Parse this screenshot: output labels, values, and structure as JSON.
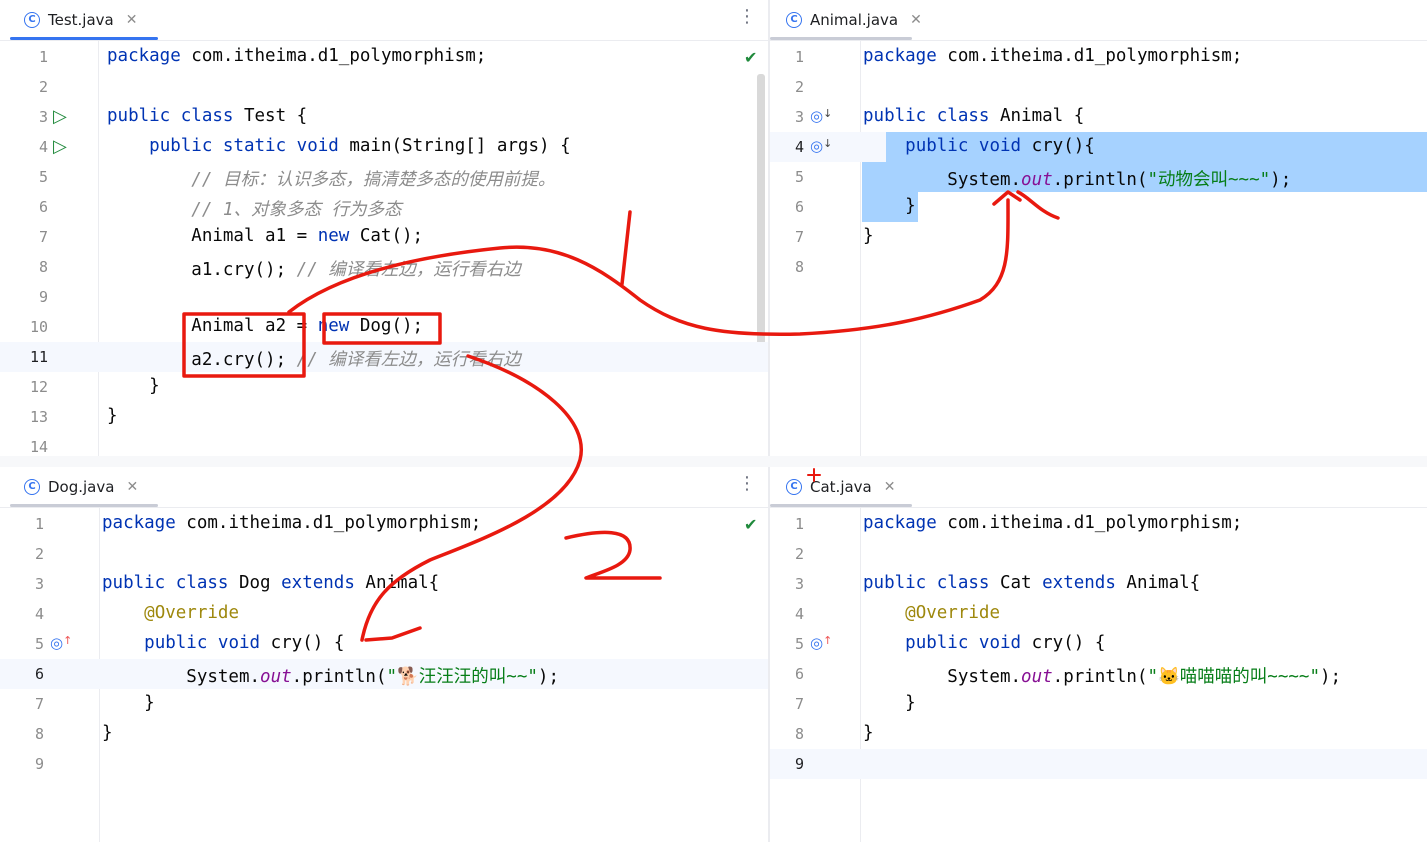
{
  "panes": {
    "test": {
      "tab": "Test.java",
      "lines": [
        {
          "n": "1",
          "code": [
            {
              "t": "package",
              "c": "kw"
            },
            {
              "t": " com.itheima.d1_polymorphism;"
            }
          ]
        },
        {
          "n": "2",
          "code": []
        },
        {
          "n": "3",
          "code": [
            {
              "t": "public class",
              "c": "kw"
            },
            {
              "t": " Test {"
            }
          ],
          "icon": "run"
        },
        {
          "n": "4",
          "code": [
            {
              "t": "    "
            },
            {
              "t": "public static void",
              "c": "kw"
            },
            {
              "t": " main(String[] args) {"
            }
          ],
          "icon": "run"
        },
        {
          "n": "5",
          "code": [
            {
              "t": "        "
            },
            {
              "t": "// 目标：认识多态，搞清楚多态的使用前提。",
              "c": "cm"
            }
          ]
        },
        {
          "n": "6",
          "code": [
            {
              "t": "        "
            },
            {
              "t": "// 1、对象多态 行为多态",
              "c": "cm"
            }
          ]
        },
        {
          "n": "7",
          "code": [
            {
              "t": "        Animal a1 = "
            },
            {
              "t": "new",
              "c": "kw"
            },
            {
              "t": " Cat();"
            }
          ]
        },
        {
          "n": "8",
          "code": [
            {
              "t": "        a1.cry(); "
            },
            {
              "t": "// 编译看左边，运行看右边",
              "c": "cm"
            }
          ]
        },
        {
          "n": "9",
          "code": []
        },
        {
          "n": "10",
          "code": [
            {
              "t": "        Animal a2 = "
            },
            {
              "t": "new",
              "c": "kw"
            },
            {
              "t": " Dog();"
            }
          ]
        },
        {
          "n": "11",
          "code": [
            {
              "t": "        a2.cry(); "
            },
            {
              "t": "// 编译看左边，运行看右边",
              "c": "cm"
            }
          ],
          "current": true
        },
        {
          "n": "12",
          "code": [
            {
              "t": "    }"
            }
          ]
        },
        {
          "n": "13",
          "code": [
            {
              "t": "}"
            }
          ]
        },
        {
          "n": "14",
          "code": []
        }
      ]
    },
    "animal": {
      "tab": "Animal.java",
      "lines": [
        {
          "n": "1",
          "code": [
            {
              "t": "package",
              "c": "kw"
            },
            {
              "t": " com.itheima.d1_polymorphism;"
            }
          ]
        },
        {
          "n": "2",
          "code": []
        },
        {
          "n": "3",
          "code": [
            {
              "t": "public class",
              "c": "kw"
            },
            {
              "t": " Animal {"
            }
          ],
          "icon": "ovdown"
        },
        {
          "n": "4",
          "code": [
            {
              "t": "    "
            },
            {
              "t": "public void",
              "c": "kw"
            },
            {
              "t": " cry(){"
            }
          ],
          "icon": "ovdown",
          "current": true,
          "sel": true
        },
        {
          "n": "5",
          "code": [
            {
              "t": "        System."
            },
            {
              "t": "out",
              "c": "fld"
            },
            {
              "t": ".println("
            },
            {
              "t": "\"动物会叫~~~\"",
              "c": "st"
            },
            {
              "t": ");"
            }
          ],
          "sel": true
        },
        {
          "n": "6",
          "code": [
            {
              "t": "    }"
            }
          ],
          "sel": true
        },
        {
          "n": "7",
          "code": [
            {
              "t": "}"
            }
          ]
        },
        {
          "n": "8",
          "code": []
        }
      ]
    },
    "dog": {
      "tab": "Dog.java",
      "lines": [
        {
          "n": "1",
          "code": [
            {
              "t": "package",
              "c": "kw"
            },
            {
              "t": " com.itheima.d1_polymorphism;"
            }
          ]
        },
        {
          "n": "2",
          "code": []
        },
        {
          "n": "3",
          "code": [
            {
              "t": "public class",
              "c": "kw"
            },
            {
              "t": " Dog "
            },
            {
              "t": "extends",
              "c": "kw"
            },
            {
              "t": " Animal{"
            }
          ]
        },
        {
          "n": "4",
          "code": [
            {
              "t": "    "
            },
            {
              "t": "@Override",
              "c": "an"
            }
          ]
        },
        {
          "n": "5",
          "code": [
            {
              "t": "    "
            },
            {
              "t": "public void",
              "c": "kw"
            },
            {
              "t": " cry() {"
            }
          ],
          "icon": "ovup"
        },
        {
          "n": "6",
          "code": [
            {
              "t": "        System."
            },
            {
              "t": "out",
              "c": "fld"
            },
            {
              "t": ".println("
            },
            {
              "t": "\"🐕汪汪汪的叫~~\"",
              "c": "st"
            },
            {
              "t": ");"
            }
          ],
          "current": true
        },
        {
          "n": "7",
          "code": [
            {
              "t": "    }"
            }
          ]
        },
        {
          "n": "8",
          "code": [
            {
              "t": "}"
            }
          ]
        },
        {
          "n": "9",
          "code": []
        }
      ]
    },
    "cat": {
      "tab": "Cat.java",
      "lines": [
        {
          "n": "1",
          "code": [
            {
              "t": "package",
              "c": "kw"
            },
            {
              "t": " com.itheima.d1_polymorphism;"
            }
          ]
        },
        {
          "n": "2",
          "code": []
        },
        {
          "n": "3",
          "code": [
            {
              "t": "public class",
              "c": "kw"
            },
            {
              "t": " Cat "
            },
            {
              "t": "extends",
              "c": "kw"
            },
            {
              "t": " Animal{"
            }
          ]
        },
        {
          "n": "4",
          "code": [
            {
              "t": "    "
            },
            {
              "t": "@Override",
              "c": "an"
            }
          ]
        },
        {
          "n": "5",
          "code": [
            {
              "t": "    "
            },
            {
              "t": "public void",
              "c": "kw"
            },
            {
              "t": " cry() {"
            }
          ],
          "icon": "ovup"
        },
        {
          "n": "6",
          "code": [
            {
              "t": "        System."
            },
            {
              "t": "out",
              "c": "fld"
            },
            {
              "t": ".println("
            },
            {
              "t": "\"🐱喵喵喵的叫~~~~\"",
              "c": "st"
            },
            {
              "t": ");"
            }
          ]
        },
        {
          "n": "7",
          "code": [
            {
              "t": "    }"
            }
          ]
        },
        {
          "n": "8",
          "code": [
            {
              "t": "}"
            }
          ]
        },
        {
          "n": "9",
          "code": []
        }
      ],
      "current_line": "9"
    }
  },
  "annotations": {
    "number_1": "1",
    "number_2": "2",
    "color": "#e8190f"
  },
  "colors": {
    "keyword": "#0033b3",
    "comment": "#8c8c8c",
    "string": "#067d17",
    "annotation": "#9e880d",
    "field": "#871094",
    "tab_accent": "#3574f0",
    "selection": "#a6d2ff"
  }
}
